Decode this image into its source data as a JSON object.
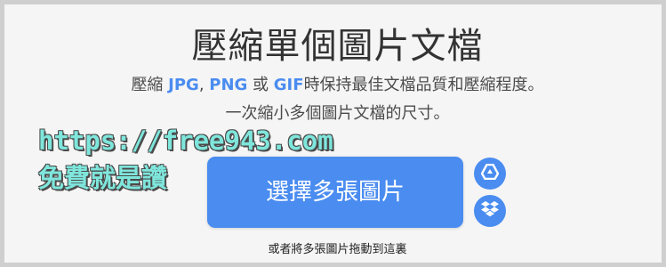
{
  "header": {
    "title": "壓縮單個圖片文檔",
    "desc_prefix": "壓縮 ",
    "format_jpg": "JPG",
    "sep": ", ",
    "format_png": "PNG",
    "or": " 或 ",
    "format_gif": "GIF",
    "desc_suffix": "時保持最佳文檔品質和壓縮程度。",
    "subtitle": "一次縮小多個圖片文檔的尺寸。"
  },
  "watermark": {
    "url": "https://free943.com",
    "slogan": "免費就是讚"
  },
  "upload": {
    "select_label": "選擇多張圖片",
    "drop_hint": "或者將多張圖片拖動到這裏"
  },
  "icons": {
    "google_drive": "google-drive-icon",
    "dropbox": "dropbox-icon"
  },
  "colors": {
    "accent": "#4a8cf0",
    "background": "#f5f5f5",
    "border": "#cfcfcf",
    "watermark": "#7fe6dc"
  }
}
